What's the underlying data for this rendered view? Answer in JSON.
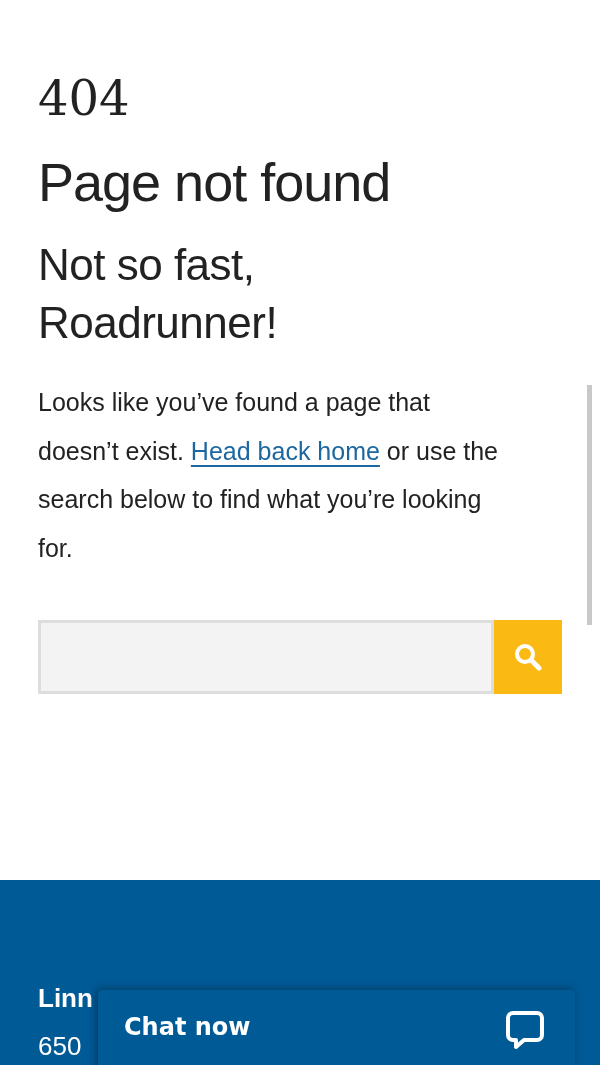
{
  "error_code": "404",
  "title": "Page not found",
  "subtitle": "Not so fast, Roadrunner!",
  "message": {
    "before": "Looks like you’ve found a page that doesn’t exist. ",
    "link": "Head back home",
    "after": " or use the search below to find what you’re looking for."
  },
  "footer": {
    "lines": [
      "Linn",
      "650"
    ]
  },
  "chat": {
    "label": "Chat now"
  }
}
